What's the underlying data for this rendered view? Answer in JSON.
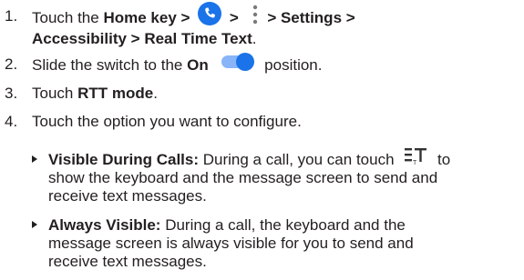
{
  "steps": [
    {
      "num": "1.",
      "t1": "Touch the ",
      "home": "Home",
      "t2": " key ",
      "gt1": ">",
      "gt2": ">",
      "path": "> Settings >",
      "line2": "Accessibility > Real Time Text",
      "period": "."
    },
    {
      "num": "2.",
      "t1": "Slide the switch to the ",
      "on": "On",
      "t2": " position."
    },
    {
      "num": "3.",
      "t1": "Touch ",
      "bold": "RTT mode",
      "t2": "."
    },
    {
      "num": "4.",
      "text": "Touch the option you want to configure."
    }
  ],
  "options": [
    {
      "label": "Visible During Calls:",
      "l1": " During a call, you can touch ",
      "l1b": " to",
      "l2": "show the keyboard and the message screen to send and",
      "l3": "receive text messages."
    },
    {
      "label": "Always Visible:",
      "l1": " During a call, the keyboard and the",
      "l2": "message screen is always visible for you to send and",
      "l3": "receive text messages."
    }
  ],
  "icons": {
    "phone": "phone-icon",
    "more": "more-vertical-icon",
    "toggle": "toggle-switch-icon",
    "rtt": "rtt-keyboard-icon"
  },
  "colors": {
    "accent": "#1a73e8",
    "toggle_track": "#8ab4f8",
    "text": "#231f20"
  }
}
